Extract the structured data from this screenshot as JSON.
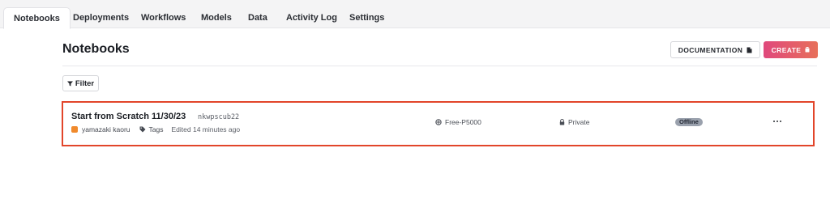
{
  "tabs": [
    {
      "label": "Notebooks",
      "active": true
    },
    {
      "label": "Deployments"
    },
    {
      "label": "Workflows"
    },
    {
      "label": "Models"
    },
    {
      "label": "Data"
    },
    {
      "label": "Activity Log"
    },
    {
      "label": "Settings"
    }
  ],
  "page": {
    "title": "Notebooks",
    "documentation_label": "DOCUMENTATION",
    "create_label": "CREATE",
    "filter_label": "Filter"
  },
  "notebooks": [
    {
      "title": "Start from Scratch 11/30/23",
      "id": "nkwpscub22",
      "owner": "yamazaki kaoru",
      "tags_label": "Tags",
      "edited": "Edited 14 minutes ago",
      "machine": "Free-P5000",
      "privacy": "Private",
      "status": "Offline",
      "more_icon": "more-horizontal-icon"
    }
  ],
  "colors": {
    "accent_border": "#e2452a",
    "create_gradient_start": "#e0487c",
    "create_gradient_end": "#e7705a",
    "avatar": "#f08a2c",
    "status_badge": "#9aa1ad"
  },
  "icons": {
    "documentation": "file-icon",
    "create": "trash-icon",
    "filter": "filter-icon",
    "tags": "tag-icon",
    "machine": "gpu-icon",
    "privacy": "lock-icon"
  }
}
